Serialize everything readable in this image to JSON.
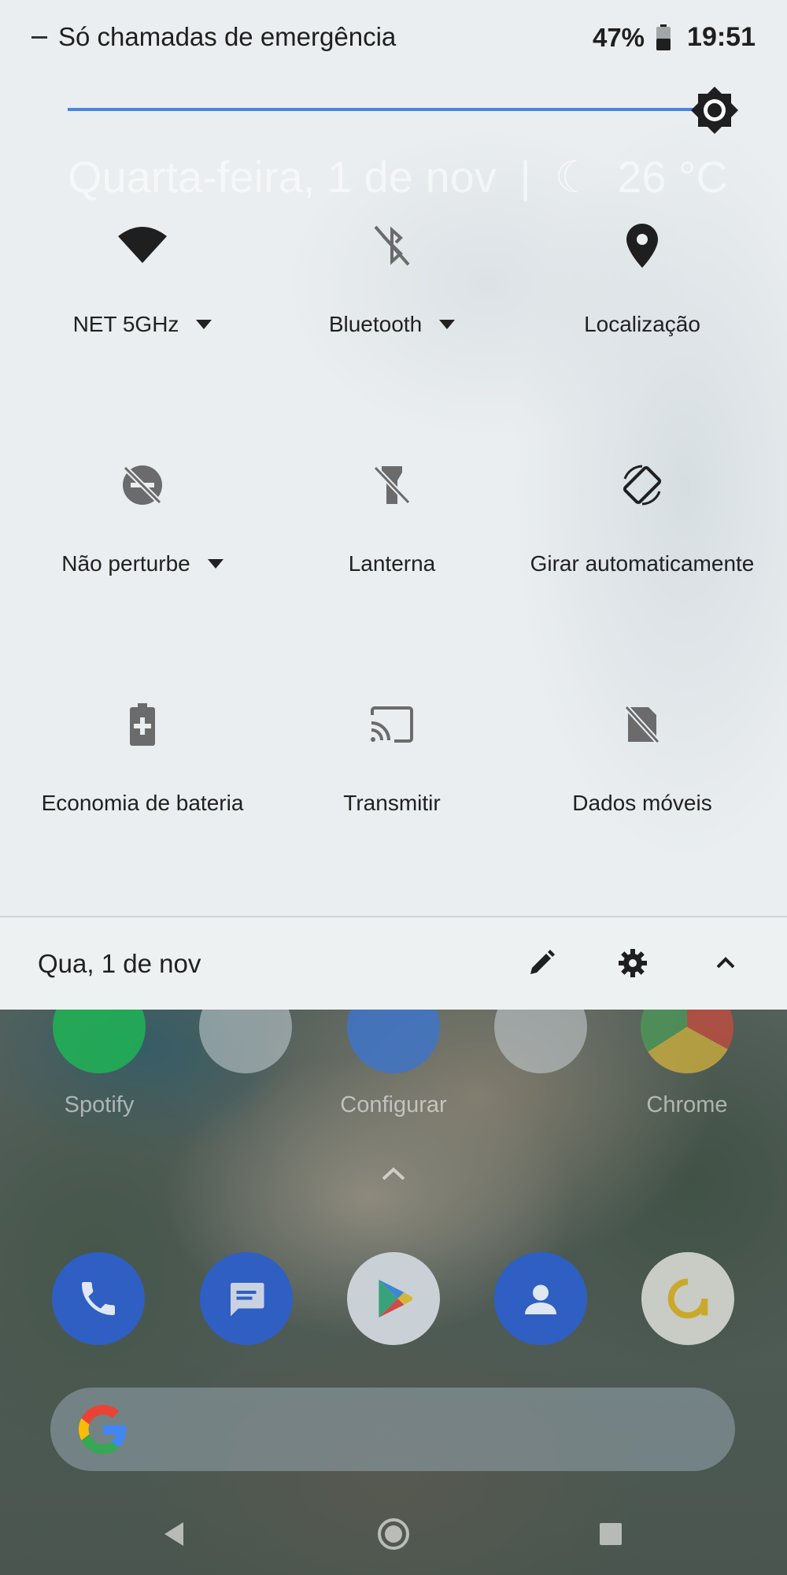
{
  "status_bar": {
    "left_text": "Só chamadas de emergência",
    "battery_percent": "47%",
    "time": "19:51"
  },
  "brightness": {
    "level_fraction": 0.95,
    "icon": "brightness-icon"
  },
  "ghost_date": {
    "date": "Quarta-feira, 1 de nov",
    "separator": "|",
    "weather_temp": "26 °C"
  },
  "tiles": [
    {
      "label": "NET 5GHz",
      "icon": "wifi-icon",
      "has_dropdown": true
    },
    {
      "label": "Bluetooth",
      "icon": "bluetooth-off-icon",
      "has_dropdown": true
    },
    {
      "label": "Localização",
      "icon": "location-icon",
      "has_dropdown": false
    },
    {
      "label": "Não perturbe",
      "icon": "do-not-disturb-off-icon",
      "has_dropdown": true
    },
    {
      "label": "Lanterna",
      "icon": "flashlight-off-icon",
      "has_dropdown": false
    },
    {
      "label": "Girar automaticamente",
      "icon": "auto-rotate-icon",
      "has_dropdown": false
    },
    {
      "label": "Economia de bateria",
      "icon": "battery-saver-icon",
      "has_dropdown": false
    },
    {
      "label": "Transmitir",
      "icon": "cast-icon",
      "has_dropdown": false
    },
    {
      "label": "Dados móveis",
      "icon": "no-sim-icon",
      "has_dropdown": false
    }
  ],
  "footer": {
    "date": "Qua, 1 de nov",
    "edit_icon": "edit-icon",
    "settings_icon": "gear-icon",
    "collapse_icon": "chevron-up-icon"
  },
  "home_apps": [
    {
      "label": "Spotify",
      "icon": "spotify-icon"
    },
    {
      "label": "",
      "icon": "folder-icon"
    },
    {
      "label": "Configurar",
      "icon": "settings-app-icon"
    },
    {
      "label": "",
      "icon": "folder-icon"
    },
    {
      "label": "Chrome",
      "icon": "chrome-icon"
    }
  ],
  "dock": [
    {
      "icon": "phone-icon"
    },
    {
      "icon": "messages-icon"
    },
    {
      "icon": "play-store-icon"
    },
    {
      "icon": "contacts-icon"
    },
    {
      "icon": "allo-icon"
    }
  ],
  "colors": {
    "accent": "#4a84e4",
    "shade_background": "#eaeef0",
    "icon_active": "#1f1f1f",
    "icon_inactive": "#6b6b6b"
  }
}
